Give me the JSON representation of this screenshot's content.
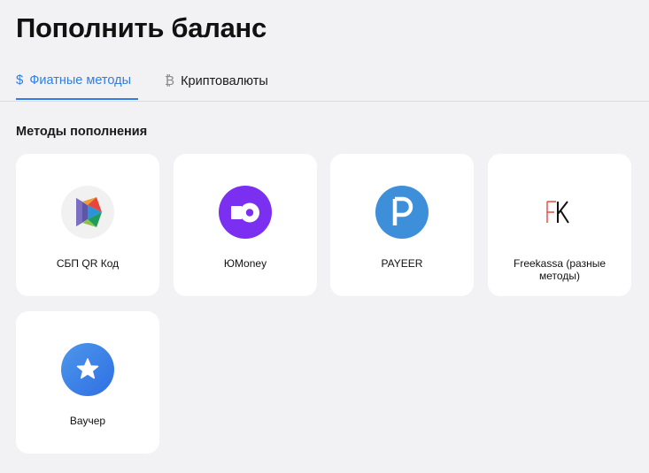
{
  "page": {
    "title": "Пополнить баланс"
  },
  "tabs": [
    {
      "label": "Фиатные методы",
      "icon": "dollar-icon",
      "glyph": "$",
      "active": true
    },
    {
      "label": "Криптовалюты",
      "icon": "bitcoin-icon",
      "glyph": "₿",
      "active": false
    }
  ],
  "section": {
    "title": "Методы пополнения"
  },
  "methods": [
    {
      "label": "СБП QR Код",
      "icon": "sbp-logo"
    },
    {
      "label": "ЮMoney",
      "icon": "yoomoney-logo"
    },
    {
      "label": "PAYEER",
      "icon": "payeer-logo",
      "glyph": "P"
    },
    {
      "label": "Freekassa (разные методы)",
      "icon": "freekassa-logo",
      "glyph_f": "F",
      "glyph_k": "K"
    },
    {
      "label": "Ваучер",
      "icon": "voucher-star-logo"
    }
  ],
  "colors": {
    "accent": "#2f7ee0",
    "background": "#f2f2f4",
    "card": "#ffffff",
    "yoomoney": "#7b2ff0",
    "payeer": "#3d8fda",
    "freekassa_f": "#e8483c",
    "voucher": "#3d80e6"
  }
}
